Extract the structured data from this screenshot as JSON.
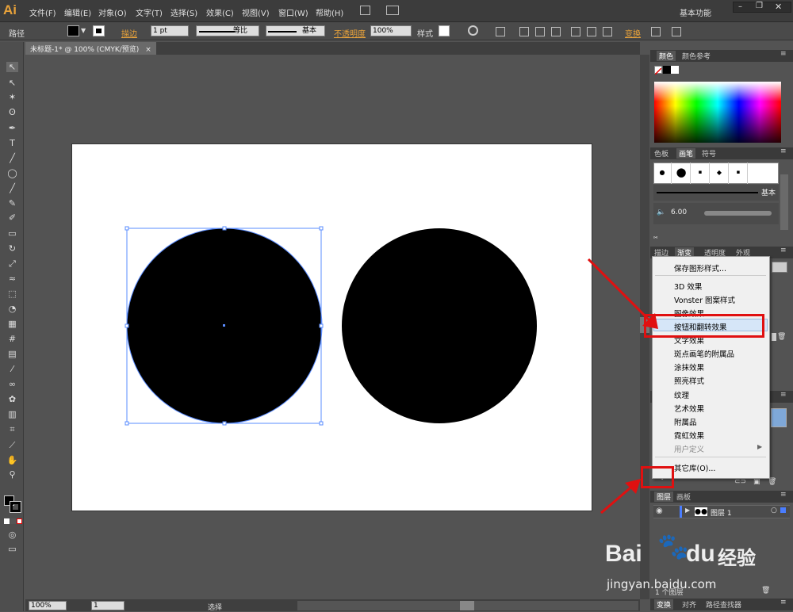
{
  "app": {
    "logo": "Ai",
    "workspace": "基本功能"
  },
  "menu": [
    "文件(F)",
    "编辑(E)",
    "对象(O)",
    "文字(T)",
    "选择(S)",
    "效果(C)",
    "视图(V)",
    "窗口(W)",
    "帮助(H)"
  ],
  "control": {
    "mode": "路径",
    "stroke_label": "描边",
    "stroke_weight": "1 pt",
    "stroke_profile": "等比",
    "brush": "基本",
    "opacity_label": "不透明度",
    "opacity": "100%",
    "style_label": "样式",
    "transform_label": "变换"
  },
  "document": {
    "tab_title": "未标题-1* @ 100% (CMYK/预览)"
  },
  "status": {
    "zoom": "100%",
    "artboard": "1",
    "tool": "选择"
  },
  "panels": {
    "color_tabs": [
      "颜色",
      "颜色参考"
    ],
    "brush_tabs": [
      "色板",
      "画笔",
      "符号"
    ],
    "brush_basic": "基本",
    "brush_size": "6.00",
    "stroke_tabs": [
      "描边",
      "渐变",
      "透明度",
      "外观"
    ],
    "layers_tabs": [
      "图层",
      "画板"
    ],
    "layer_name": "图层 1",
    "layers_count": "1 个图层",
    "bottom_tabs": [
      "变换",
      "对齐",
      "路径查找器"
    ]
  },
  "context_menu": {
    "items": [
      "保存图形样式...",
      "3D 效果",
      "Vonster 图案样式",
      "图像效果",
      "按钮和翻转效果",
      "文字效果",
      "斑点画笔的附属品",
      "涂抹效果",
      "照亮样式",
      "纹理",
      "艺术效果",
      "附属品",
      "霓虹效果",
      "用户定义",
      "其它库(O)..."
    ],
    "highlighted": "按钮和翻转效果"
  },
  "watermark": {
    "brand": "Bai",
    "brand2": "du",
    "product": "经验",
    "url": "jingyan.baidu.com"
  },
  "colors": {
    "accent": "#e01010",
    "selection": "#5a8cff"
  }
}
